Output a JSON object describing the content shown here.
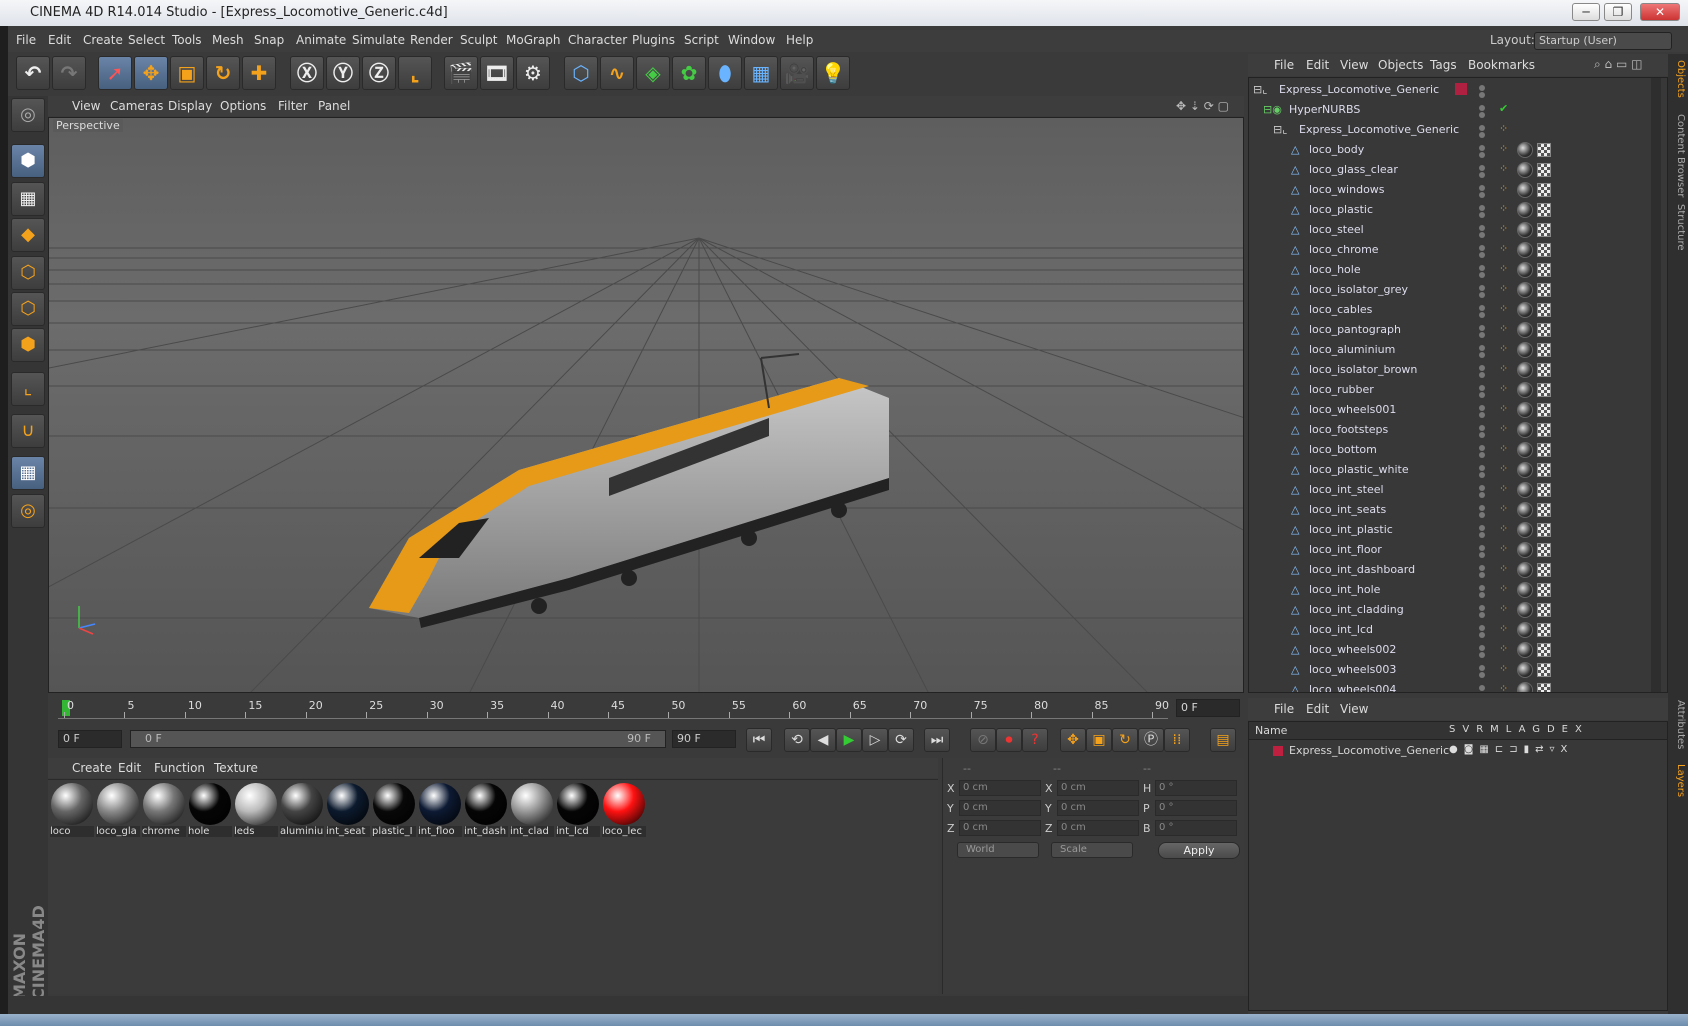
{
  "title": "CINEMA 4D R14.014 Studio - [Express_Locomotive_Generic.c4d]",
  "window_buttons": [
    "─",
    "❐",
    "✕"
  ],
  "menu": [
    "File",
    "Edit",
    "Create",
    "Select",
    "Tools",
    "Mesh",
    "Snap",
    "Animate",
    "Simulate",
    "Render",
    "Sculpt",
    "MoGraph",
    "Character",
    "Plugins",
    "Script",
    "Window",
    "Help"
  ],
  "layout": {
    "label": "Layout:",
    "value": "Startup (User)"
  },
  "viewport": {
    "menu": [
      "View",
      "Cameras",
      "Display",
      "Options",
      "Filter",
      "Panel"
    ],
    "label": "Perspective"
  },
  "timeline": {
    "ticks": [
      "0",
      "5",
      "10",
      "15",
      "20",
      "25",
      "30",
      "35",
      "40",
      "45",
      "50",
      "55",
      "60",
      "65",
      "70",
      "75",
      "80",
      "85",
      "90"
    ],
    "current_frame": "0 F"
  },
  "transport": {
    "start": "0 F",
    "range_start": "0 F",
    "range_end": "90 F",
    "end": "90 F"
  },
  "material_menu": [
    "Create",
    "Edit",
    "Function",
    "Texture"
  ],
  "materials": [
    {
      "label": "loco",
      "color": "#666666"
    },
    {
      "label": "loco_gla",
      "color": "#8a8a8a"
    },
    {
      "label": "chrome",
      "color": "#777777"
    },
    {
      "label": "hole",
      "color": "#050505"
    },
    {
      "label": "leds",
      "color": "#bbbbbb"
    },
    {
      "label": "aluminiu",
      "color": "#444444"
    },
    {
      "label": "int_seat",
      "color": "#0c1a2e"
    },
    {
      "label": "plastic_I",
      "color": "#080808"
    },
    {
      "label": "int_floo",
      "color": "#0d1a33"
    },
    {
      "label": "int_dash",
      "color": "#050505"
    },
    {
      "label": "int_clad",
      "color": "#999999"
    },
    {
      "label": "int_lcd",
      "color": "#050505"
    },
    {
      "label": "loco_lec",
      "color": "#ff1111"
    }
  ],
  "coords": {
    "headers": [
      "--",
      "--",
      "--"
    ],
    "rows": [
      {
        "a": "X",
        "av": "0 cm",
        "b": "X",
        "bv": "0 cm",
        "c": "H",
        "cv": "0 °"
      },
      {
        "a": "Y",
        "av": "0 cm",
        "b": "Y",
        "bv": "0 cm",
        "c": "P",
        "cv": "0 °"
      },
      {
        "a": "Z",
        "av": "0 cm",
        "b": "Z",
        "bv": "0 cm",
        "c": "B",
        "cv": "0 °"
      }
    ],
    "mode1": "World",
    "mode2": "Scale",
    "apply": "Apply"
  },
  "objects_menu": [
    "File",
    "Edit",
    "View",
    "Objects",
    "Tags",
    "Bookmarks"
  ],
  "objects_tree": [
    {
      "name": "Express_Locomotive_Generic",
      "level": 0
    },
    {
      "name": "HyperNURBS",
      "level": 1
    },
    {
      "name": "Express_Locomotive_Generic",
      "level": 2
    },
    {
      "name": "loco_body",
      "level": 3
    },
    {
      "name": "loco_glass_clear",
      "level": 3
    },
    {
      "name": "loco_windows",
      "level": 3
    },
    {
      "name": "loco_plastic",
      "level": 3
    },
    {
      "name": "loco_steel",
      "level": 3
    },
    {
      "name": "loco_chrome",
      "level": 3
    },
    {
      "name": "loco_hole",
      "level": 3
    },
    {
      "name": "loco_isolator_grey",
      "level": 3
    },
    {
      "name": "loco_cables",
      "level": 3
    },
    {
      "name": "loco_pantograph",
      "level": 3
    },
    {
      "name": "loco_aluminium",
      "level": 3
    },
    {
      "name": "loco_isolator_brown",
      "level": 3
    },
    {
      "name": "loco_rubber",
      "level": 3
    },
    {
      "name": "loco_wheels001",
      "level": 3
    },
    {
      "name": "loco_footsteps",
      "level": 3
    },
    {
      "name": "loco_bottom",
      "level": 3
    },
    {
      "name": "loco_plastic_white",
      "level": 3
    },
    {
      "name": "loco_int_steel",
      "level": 3
    },
    {
      "name": "loco_int_seats",
      "level": 3
    },
    {
      "name": "loco_int_plastic",
      "level": 3
    },
    {
      "name": "loco_int_floor",
      "level": 3
    },
    {
      "name": "loco_int_dashboard",
      "level": 3
    },
    {
      "name": "loco_int_hole",
      "level": 3
    },
    {
      "name": "loco_int_cladding",
      "level": 3
    },
    {
      "name": "loco_int_lcd",
      "level": 3
    },
    {
      "name": "loco_wheels002",
      "level": 3
    },
    {
      "name": "loco_wheels003",
      "level": 3
    },
    {
      "name": "loco_wheels004",
      "level": 3
    }
  ],
  "layers_menu": [
    "File",
    "Edit",
    "View"
  ],
  "layers_header": {
    "name": "Name",
    "cols": [
      "S",
      "V",
      "R",
      "M",
      "L",
      "A",
      "G",
      "D",
      "E",
      "X"
    ]
  },
  "layers": [
    {
      "name": "Express_Locomotive_Generic"
    }
  ],
  "side_tabs": [
    "Objects",
    "Content Browser",
    "Structure",
    "Attributes",
    "Layers"
  ],
  "brand": "MAXON CINEMA4D",
  "toolbar_icons": [
    "undo-icon",
    "redo-icon",
    "live-selection-icon",
    "move-icon",
    "scale-icon",
    "rotate-icon",
    "add-icon",
    "x-axis-icon",
    "y-axis-icon",
    "z-axis-icon",
    "coordinate-system-icon",
    "render-view-icon",
    "render-picture-viewer-icon",
    "render-settings-icon",
    "cube-icon",
    "spline-icon",
    "nurbs-icon",
    "array-icon",
    "deformer-icon",
    "floor-icon",
    "camera-icon",
    "light-icon"
  ]
}
